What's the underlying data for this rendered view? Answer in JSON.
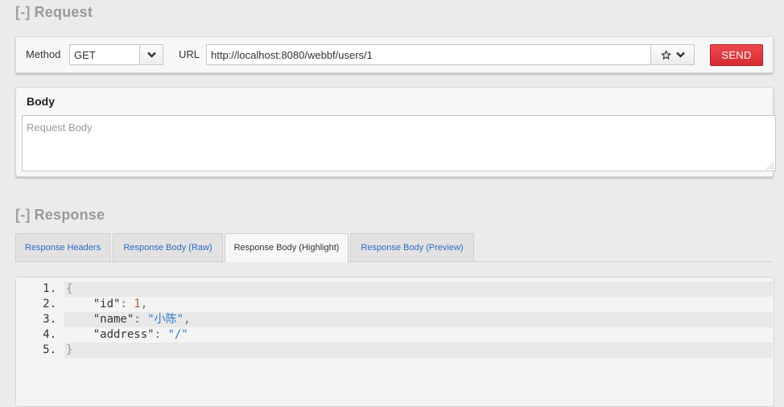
{
  "request": {
    "toggle": "[-]",
    "title": "Request",
    "method_label": "Method",
    "method_value": "GET",
    "url_label": "URL",
    "url_value": "http://localhost:8080/webbf/users/1",
    "send_label": "SEND",
    "send_color": "#e0353b"
  },
  "body": {
    "title": "Body",
    "placeholder": "Request Body"
  },
  "response": {
    "toggle": "[-]",
    "title": "Response",
    "tabs": [
      {
        "label": "Response Headers",
        "active": false
      },
      {
        "label": "Response Body (Raw)",
        "active": false
      },
      {
        "label": "Response Body (Highlight)",
        "active": true
      },
      {
        "label": "Response Body (Preview)",
        "active": false
      }
    ],
    "code": {
      "line_numbers": [
        "1.",
        "2.",
        "3.",
        "4.",
        "5."
      ],
      "line1": "{",
      "line2_key": "\"id\"",
      "line2_colon": ": ",
      "line2_value": "1",
      "line2_comma": ",",
      "line3_key": "\"name\"",
      "line3_colon": ": ",
      "line3_value": "\"小陈\"",
      "line3_comma": ",",
      "line4_key": "\"address\"",
      "line4_colon": ": ",
      "line4_value": "\"/\"",
      "line5": "}"
    }
  },
  "icons": {
    "method_dropdown": "chevron-down-icon",
    "favorite": "star-icon",
    "url_dropdown": "chevron-down-icon",
    "resize": "resize-grip-icon"
  }
}
